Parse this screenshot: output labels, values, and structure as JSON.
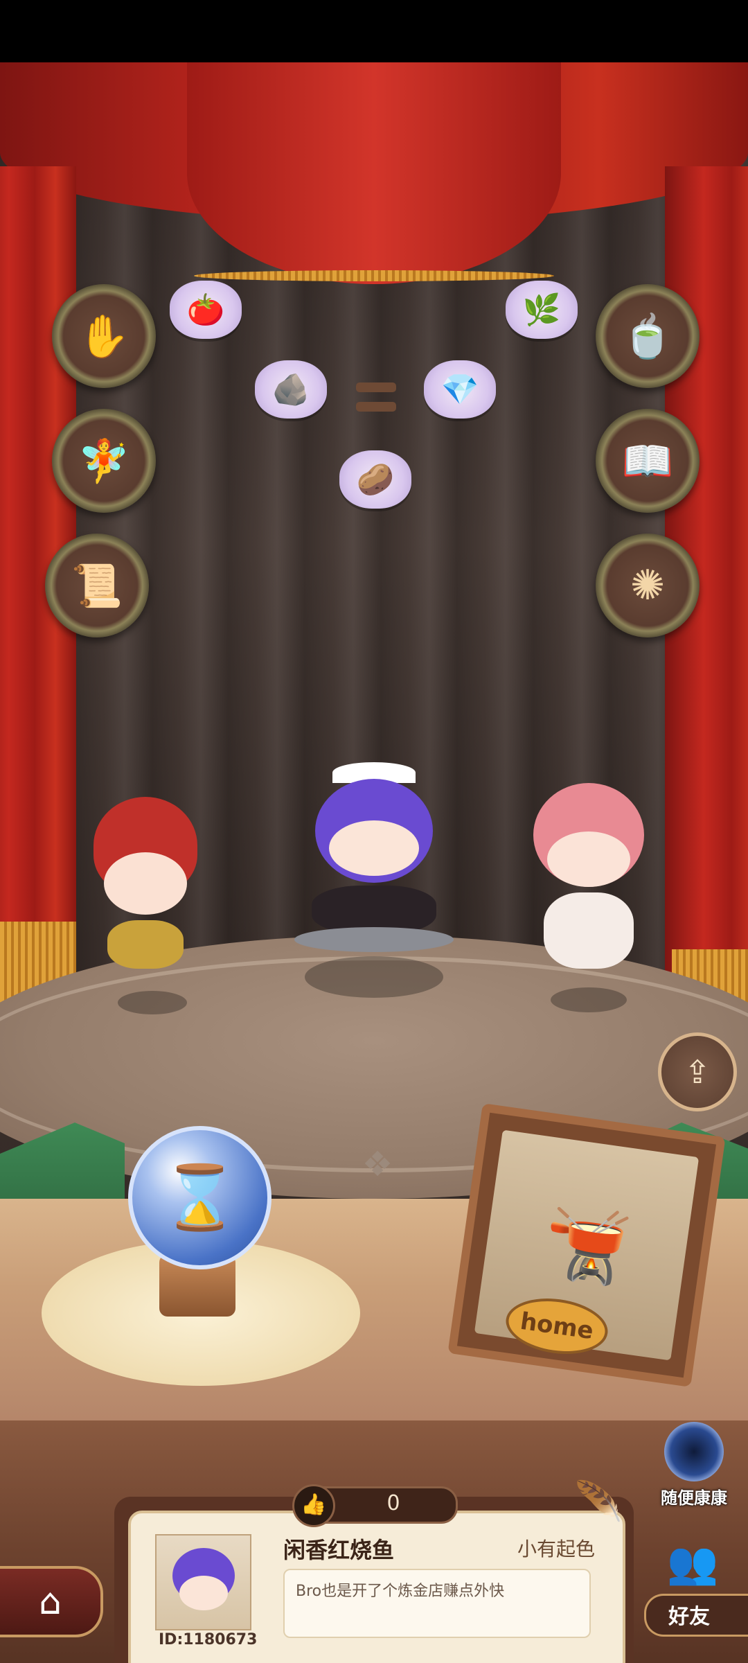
{
  "player": {
    "name": "闲香红烧鱼",
    "id_label": "ID:1180673",
    "title": "小有起色",
    "motto": "Bro也是开了个炼金店赚点外快",
    "likes": "0"
  },
  "buttons": {
    "random_visit": "随便康康",
    "friends": "好友",
    "home_sign": "home"
  },
  "icons": {
    "left_badges": [
      "hand-plant-icon",
      "fairy-icon",
      "scroll-icon"
    ],
    "right_badges": [
      "cauldron-icon",
      "book-icon",
      "ornament-icon"
    ],
    "recipe_items": [
      "tomato-icon",
      "herb-icon",
      "ore-icon",
      "gem-icon",
      "rubble-icon"
    ]
  },
  "colors": {
    "curtain": "#b8251c",
    "fringe": "#d9992f",
    "backdrop": "#3d322e",
    "card": "#f6ecd8",
    "accent_blue": "#3a6fd0"
  }
}
